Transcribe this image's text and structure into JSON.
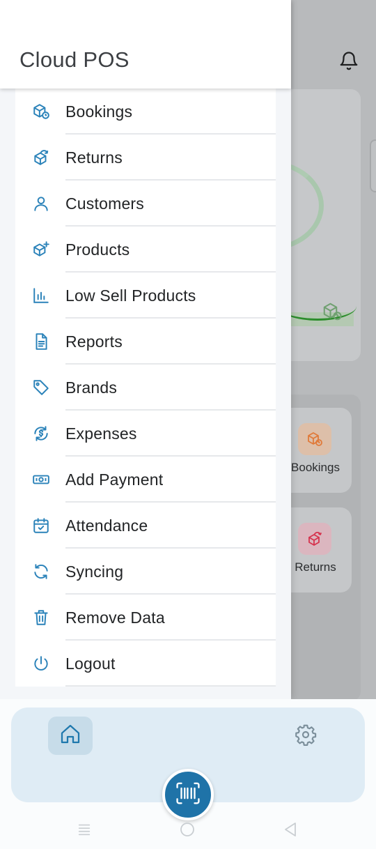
{
  "app": {
    "title": "Cloud POS"
  },
  "menu": {
    "items": [
      {
        "label": "Bookings",
        "icon": "box-clock-icon"
      },
      {
        "label": "Returns",
        "icon": "box-return-icon"
      },
      {
        "label": "Customers",
        "icon": "user-icon"
      },
      {
        "label": "Products",
        "icon": "box-plus-icon"
      },
      {
        "label": "Low Sell Products",
        "icon": "bar-chart-icon"
      },
      {
        "label": "Reports",
        "icon": "document-icon"
      },
      {
        "label": "Brands",
        "icon": "tag-icon"
      },
      {
        "label": "Expenses",
        "icon": "dollar-cycle-icon"
      },
      {
        "label": "Add Payment",
        "icon": "banknote-icon"
      },
      {
        "label": "Attendance",
        "icon": "calendar-check-icon"
      },
      {
        "label": "Syncing",
        "icon": "sync-icon"
      },
      {
        "label": "Remove Data",
        "icon": "trash-icon"
      },
      {
        "label": "Logout",
        "icon": "power-icon"
      }
    ]
  },
  "background": {
    "tiles": [
      {
        "label": "Bookings",
        "icon": "box-clock-icon",
        "color": "#e07a3a"
      },
      {
        "label": "Returns",
        "icon": "box-return-icon",
        "color": "#d6334e"
      }
    ]
  },
  "colors": {
    "accent": "#2a82b9",
    "scan_button": "#1f73a8",
    "chart_line": "#2c8d2c"
  }
}
